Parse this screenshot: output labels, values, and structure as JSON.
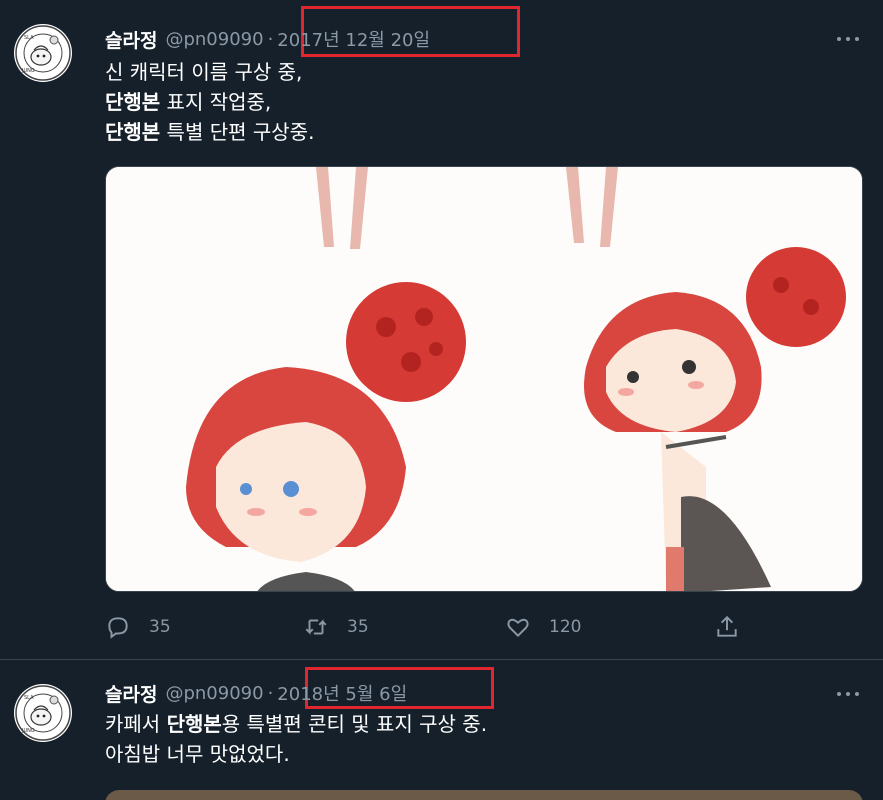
{
  "colors": {
    "background": "#15202b",
    "text": "#ffffff",
    "muted": "#8b98a5",
    "highlight": "#e0262f"
  },
  "tweets": [
    {
      "name": "슬라정",
      "handle": "@pn09090",
      "separator": "·",
      "date": "2017년 12월 20일",
      "lines": [
        {
          "pre": "",
          "bold": "",
          "post": "신 캐릭터 이름 구상 중,"
        },
        {
          "pre": "",
          "bold": "단행본",
          "post": " 표지 작업중,"
        },
        {
          "pre": "",
          "bold": "단행본",
          "post": " 특별 단편 구상중."
        }
      ],
      "stats": {
        "replies": "35",
        "retweets": "35",
        "likes": "120"
      }
    },
    {
      "name": "슬라정",
      "handle": "@pn09090",
      "separator": "·",
      "date": "2018년 5월 6일",
      "lines": [
        {
          "pre": "카페서 ",
          "bold": "단행본",
          "post": "용 특별편 콘티 및 표지 구상 중."
        },
        {
          "pre": "",
          "bold": "",
          "post": "아침밥 너무 맛없었다."
        }
      ]
    }
  ],
  "icons": [
    "more-icon",
    "reply-icon",
    "retweet-icon",
    "like-icon",
    "share-icon"
  ]
}
